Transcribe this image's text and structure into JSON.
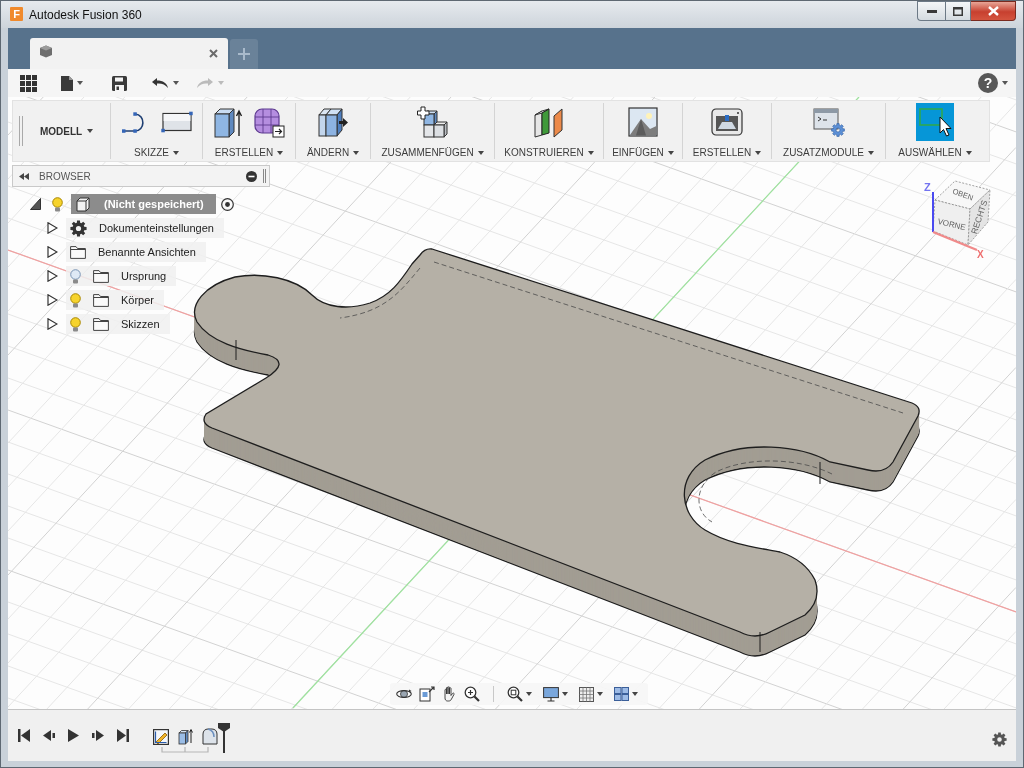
{
  "window": {
    "logo": "F",
    "title": "Autodesk Fusion 360"
  },
  "quick_access": {
    "undo": {
      "disabled": false
    },
    "redo": {
      "disabled": true
    },
    "help": {
      "label": "?"
    }
  },
  "ribbon": {
    "workspace": "MODELL",
    "groups": [
      {
        "kind": "sketch",
        "label": "SKIZZE",
        "active": false
      },
      {
        "kind": "create",
        "label": "ERSTELLEN",
        "active": false
      },
      {
        "kind": "modify",
        "label": "ÄNDERN",
        "active": false
      },
      {
        "kind": "assemble",
        "label": "ZUSAMMENFÜGEN",
        "active": false
      },
      {
        "kind": "construct",
        "label": "KONSTRUIEREN",
        "active": false
      },
      {
        "kind": "insert",
        "label": "EINFÜGEN",
        "active": false
      },
      {
        "kind": "make",
        "label": "ERSTELLEN",
        "active": false
      },
      {
        "kind": "addins",
        "label": "ZUSATZMODULE",
        "active": false
      },
      {
        "kind": "select",
        "label": "AUSWÄHLEN",
        "active": true
      }
    ]
  },
  "browser": {
    "title": "BROWSER",
    "root": {
      "label": "(Nicht gespeichert)",
      "expanded": true,
      "visible": true,
      "active": true,
      "children": [
        {
          "kind": "settings",
          "label": "Dokumenteinstellungen",
          "expanded": false
        },
        {
          "kind": "folder",
          "label": "Benannte Ansichten",
          "expanded": false
        },
        {
          "kind": "folder",
          "label": "Ursprung",
          "expanded": false,
          "visible": false
        },
        {
          "kind": "folder",
          "label": "Körper",
          "expanded": false,
          "visible": true
        },
        {
          "kind": "folder",
          "label": "Skizzen",
          "expanded": false,
          "visible": true
        }
      ]
    }
  },
  "view_cube": {
    "top": "OBEN",
    "front": "VORNE",
    "right": "RECHTS",
    "axes": {
      "z": "Z",
      "x": "X"
    }
  },
  "timeline": {
    "features": [
      {
        "kind": "sketch"
      },
      {
        "kind": "extrude"
      },
      {
        "kind": "fillet"
      }
    ]
  }
}
